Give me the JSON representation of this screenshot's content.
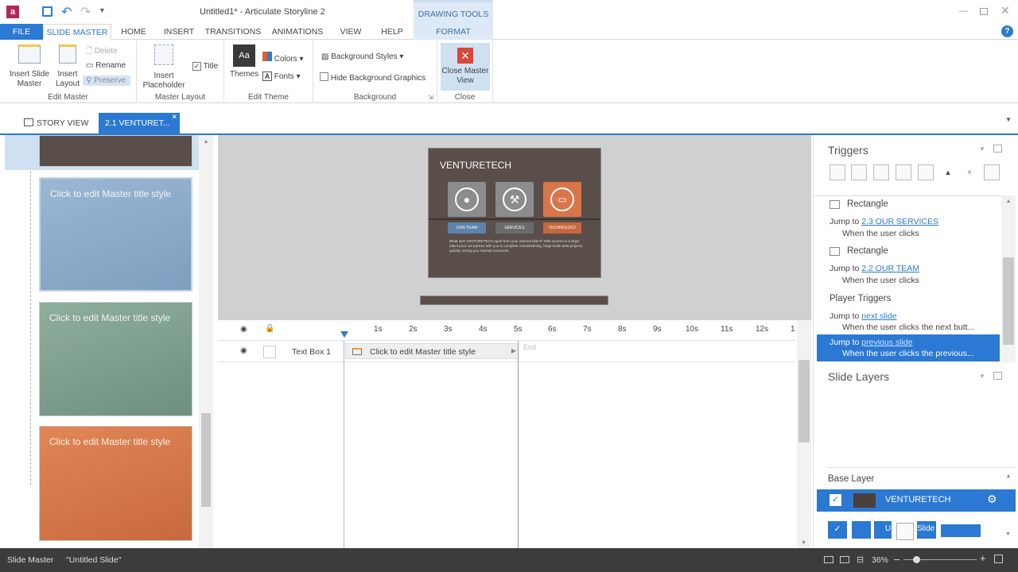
{
  "window": {
    "title": "Untitled1* - Articulate Storyline 2",
    "context_tab_group": "DRAWING TOOLS"
  },
  "ribbon_tabs": [
    "FILE",
    "SLIDE MASTER",
    "HOME",
    "INSERT",
    "TRANSITIONS",
    "ANIMATIONS",
    "VIEW",
    "HELP",
    "FORMAT"
  ],
  "ribbon": {
    "edit_master": {
      "insert_slide_master": "Insert Slide Master",
      "insert_layout": "Insert Layout",
      "delete": "Delete",
      "rename": "Rename",
      "preserve": "Preserve",
      "group": "Edit Master"
    },
    "master_layout": {
      "insert_placeholder": "Insert Placeholder",
      "title": "Title",
      "group": "Master Layout"
    },
    "edit_theme": {
      "themes": "Themes",
      "colors": "Colors",
      "fonts": "Fonts",
      "group": "Edit Theme",
      "aa": "Aa"
    },
    "background": {
      "background_styles": "Background Styles",
      "hide_background_graphics": "Hide Background Graphics",
      "group": "Background"
    },
    "close": {
      "close_master_view": "Close Master View",
      "group": "Close"
    }
  },
  "doc_tabs": {
    "story_view": "STORY VIEW",
    "current": "2.1 VENTURET..."
  },
  "thumbnails": {
    "placeholder": "Click to edit Master title style"
  },
  "slide": {
    "brand": "VENTURETECH",
    "btn1": "OUR TEAM",
    "btn2": "SERVICES",
    "btn3": "TECHNOLOGY",
    "body": "What sets VENTURETECH apart from your internal talent? With access to a large talent pool, we partner with you to complete overwhelming, large-scale data projects quickly, saving you internal resources."
  },
  "timeline": {
    "ticks": [
      "1s",
      "2s",
      "3s",
      "4s",
      "5s",
      "6s",
      "7s",
      "8s",
      "9s",
      "10s",
      "11s",
      "12s",
      "1"
    ],
    "row_name": "Text Box 1",
    "row_bar": "Click to edit Master title style",
    "end": "End"
  },
  "triggers": {
    "title": "Triggers",
    "items": [
      {
        "object": "Rectangle",
        "action": "Jump to",
        "target": "2.3 OUR SERVICES",
        "when": "When the user clicks"
      },
      {
        "object": "Rectangle",
        "action": "Jump to",
        "target": "2.2 OUR TEAM",
        "when": "When the user clicks"
      }
    ],
    "player_title": "Player Triggers",
    "player_items": [
      {
        "action": "Jump to",
        "target": "next slide",
        "when": "When the user clicks the next butt..."
      },
      {
        "action": "Jump to",
        "target": "previous slide",
        "when": "When the user clicks the previous..."
      }
    ]
  },
  "slide_layers": {
    "title": "Slide Layers",
    "base": "Base Layer",
    "layer_name": "VENTURETECH",
    "partial_u": "U",
    "partial_slide": "Slide"
  },
  "status": {
    "view": "Slide Master",
    "slide": "\"Untitled Slide\"",
    "zoom": "36%"
  },
  "colors": {
    "accent": "#2b79d2",
    "close_red": "#d9463a",
    "slide_bg": "#5a4e4a"
  }
}
